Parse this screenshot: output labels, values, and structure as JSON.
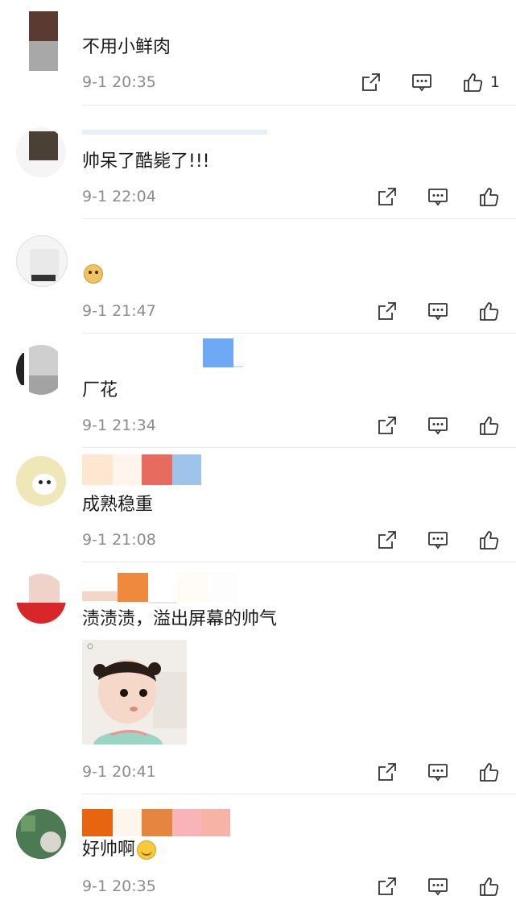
{
  "comments": [
    {
      "text": "不用小鲜肉",
      "time": "9-1 20:35",
      "like_count": "1"
    },
    {
      "text": "帅呆了酷毙了!!!",
      "time": "9-1 22:04",
      "like_count": ""
    },
    {
      "text": "",
      "time": "9-1 21:47",
      "like_count": "",
      "emoji": "dog-emoji"
    },
    {
      "text": "厂花",
      "time": "9-1 21:34",
      "like_count": ""
    },
    {
      "text": "成熟稳重",
      "time": "9-1 21:08",
      "like_count": ""
    },
    {
      "text": "渍渍渍，溢出屏幕的帅气",
      "time": "9-1 20:41",
      "like_count": "",
      "sticker": "toddler-girl-sticker"
    },
    {
      "text": "好帅啊",
      "time": "9-1 20:35",
      "like_count": "",
      "emoji": "grin-emoji"
    }
  ],
  "icons": {
    "share": "share-icon",
    "comment": "comment-icon",
    "like": "thumbs-up-icon"
  },
  "colors": {
    "text": "#1b1b1b",
    "meta": "#8c8c8c",
    "divider": "#e8e8e8"
  }
}
